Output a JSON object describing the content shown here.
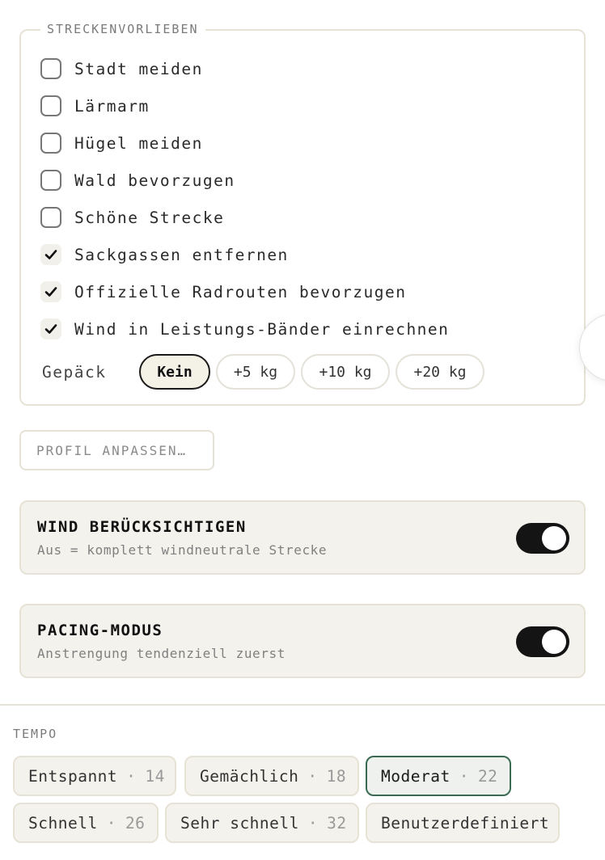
{
  "route_prefs": {
    "legend": "STRECKENVORLIEBEN",
    "options": [
      {
        "label": "Stadt meiden",
        "checked": false
      },
      {
        "label": "Lärmarm",
        "checked": false
      },
      {
        "label": "Hügel meiden",
        "checked": false
      },
      {
        "label": "Wald bevorzugen",
        "checked": false
      },
      {
        "label": "Schöne Strecke",
        "checked": false
      },
      {
        "label": "Sackgassen entfernen",
        "checked": true
      },
      {
        "label": "Offizielle Radrouten bevorzugen",
        "checked": true
      },
      {
        "label": "Wind in Leistungs-Bänder einrechnen",
        "checked": true
      }
    ],
    "luggage": {
      "label": "Gepäck",
      "options": [
        "Kein",
        "+5 kg",
        "+10 kg",
        "+20 kg"
      ],
      "selected": "Kein"
    }
  },
  "profile_button": "PROFIL ANPASSEN…",
  "wind": {
    "title": "WIND BERÜCKSICHTIGEN",
    "subtitle": "Aus = komplett windneutrale Strecke",
    "enabled": true
  },
  "pacing": {
    "title": "PACING-MODUS",
    "subtitle": "Anstrengung tendenziell zuerst",
    "enabled": true
  },
  "tempo": {
    "label": "TEMPO",
    "separator": "·",
    "options": [
      {
        "name": "Entspannt",
        "value": "14"
      },
      {
        "name": "Gemächlich",
        "value": "18"
      },
      {
        "name": "Moderat",
        "value": "22"
      },
      {
        "name": "Schnell",
        "value": "26"
      },
      {
        "name": "Sehr schnell",
        "value": "32"
      },
      {
        "name": "Benutzerdefiniert",
        "value": ""
      }
    ],
    "selected": "Moderat"
  },
  "colors": {
    "accent": "#3a6b52",
    "toggle_on": "#141414",
    "card_bg": "#f4f2ec",
    "border": "#e6e3d6"
  }
}
